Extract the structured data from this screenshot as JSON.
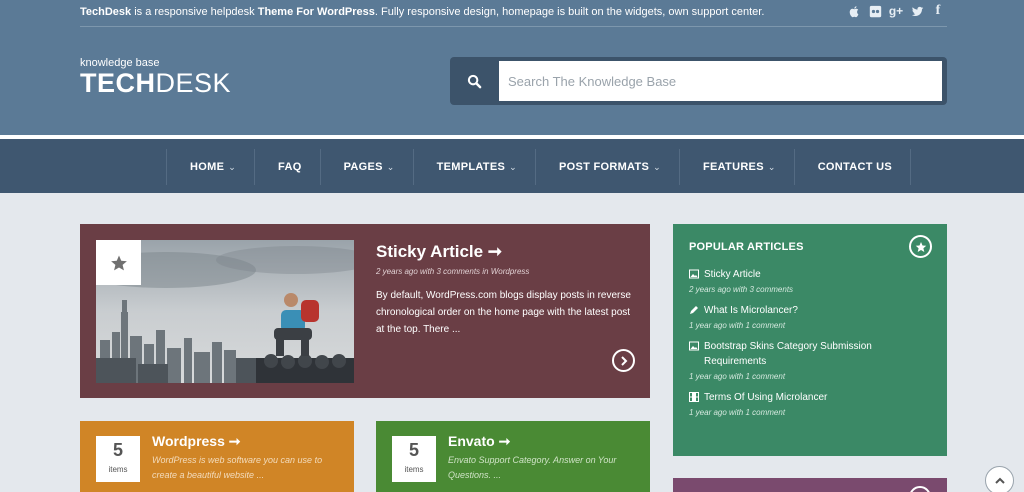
{
  "topbar": {
    "tagline_brand": "TechDesk",
    "tagline_part1": " is a responsive helpdesk ",
    "tagline_theme": "Theme For WordPress",
    "tagline_part2": ". Fully responsive design, homepage is built on the widgets, own support center.",
    "social_icons": [
      "apple-icon",
      "flickr-icon",
      "google-plus-icon",
      "twitter-icon",
      "facebook-icon"
    ]
  },
  "logo": {
    "small": "knowledge base",
    "bold": "TECH",
    "light": "DESK"
  },
  "search": {
    "placeholder": "Search The Knowledge Base"
  },
  "nav": {
    "items": [
      {
        "label": "HOME",
        "dropdown": true
      },
      {
        "label": "FAQ",
        "dropdown": false
      },
      {
        "label": "PAGES",
        "dropdown": true
      },
      {
        "label": "TEMPLATES",
        "dropdown": true
      },
      {
        "label": "POST FORMATS",
        "dropdown": true
      },
      {
        "label": "FEATURES",
        "dropdown": true
      },
      {
        "label": "CONTACT US",
        "dropdown": false
      }
    ],
    "caret": "⌄"
  },
  "sticky": {
    "title": "Sticky Article ➞",
    "meta": "2 years ago with 3 comments in Wordpress",
    "excerpt": "By default, WordPress.com blogs display posts in reverse chronological order on the home page with the latest post at the top. There ..."
  },
  "popular": {
    "title": "POPULAR ARTICLES",
    "items": [
      {
        "icon": "image-icon",
        "title": "Sticky Article",
        "meta": "2 years ago with 3 comments"
      },
      {
        "icon": "pencil-icon",
        "title": "What Is Microlancer?",
        "meta": "1 year ago with 1 comment"
      },
      {
        "icon": "image-icon",
        "title": "Bootstrap Skins Category Submission Requirements",
        "meta": "1 year ago with 1 comment"
      },
      {
        "icon": "film-icon",
        "title": "Terms Of Using Microlancer",
        "meta": "1 year ago with 1 comment"
      }
    ]
  },
  "categories": [
    {
      "count": "5",
      "count_label": "items",
      "title": "Wordpress ➞",
      "desc": "WordPress is web software you can use to create a beautiful website ..."
    },
    {
      "count": "5",
      "count_label": "items",
      "title": "Envato ➞",
      "desc": "Envato Support Category. Answer on Your Questions. ..."
    }
  ],
  "colors": {
    "header": "#5b7a96",
    "nav": "#3f5770",
    "sticky": "#6a3e45",
    "popular": "#3b8966",
    "wordpress": "#d08526",
    "envato": "#4a8a34"
  }
}
